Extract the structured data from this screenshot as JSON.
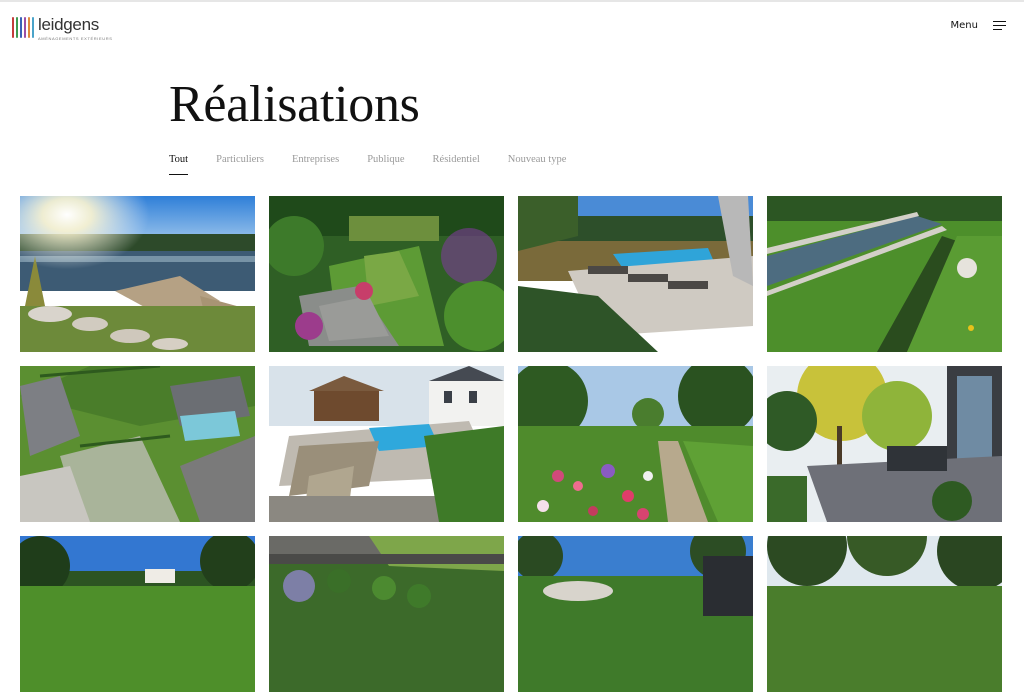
{
  "brand": {
    "name": "leidgens",
    "tagline": "AMÉNAGEMENTS EXTÉRIEURS",
    "bar_colors": [
      "#c43c3c",
      "#3f9a4f",
      "#3a62b8",
      "#9c4fa6",
      "#e28a3a",
      "#4aa3c9"
    ]
  },
  "header": {
    "menu_label": "Menu"
  },
  "page": {
    "title": "Réalisations"
  },
  "filters": [
    {
      "label": "Tout",
      "active": true
    },
    {
      "label": "Particuliers",
      "active": false
    },
    {
      "label": "Entreprises",
      "active": false
    },
    {
      "label": "Publique",
      "active": false
    },
    {
      "label": "Résidentiel",
      "active": false
    },
    {
      "label": "Nouveau type",
      "active": false
    }
  ],
  "icons": {
    "menu": "hamburger-menu-icon"
  }
}
